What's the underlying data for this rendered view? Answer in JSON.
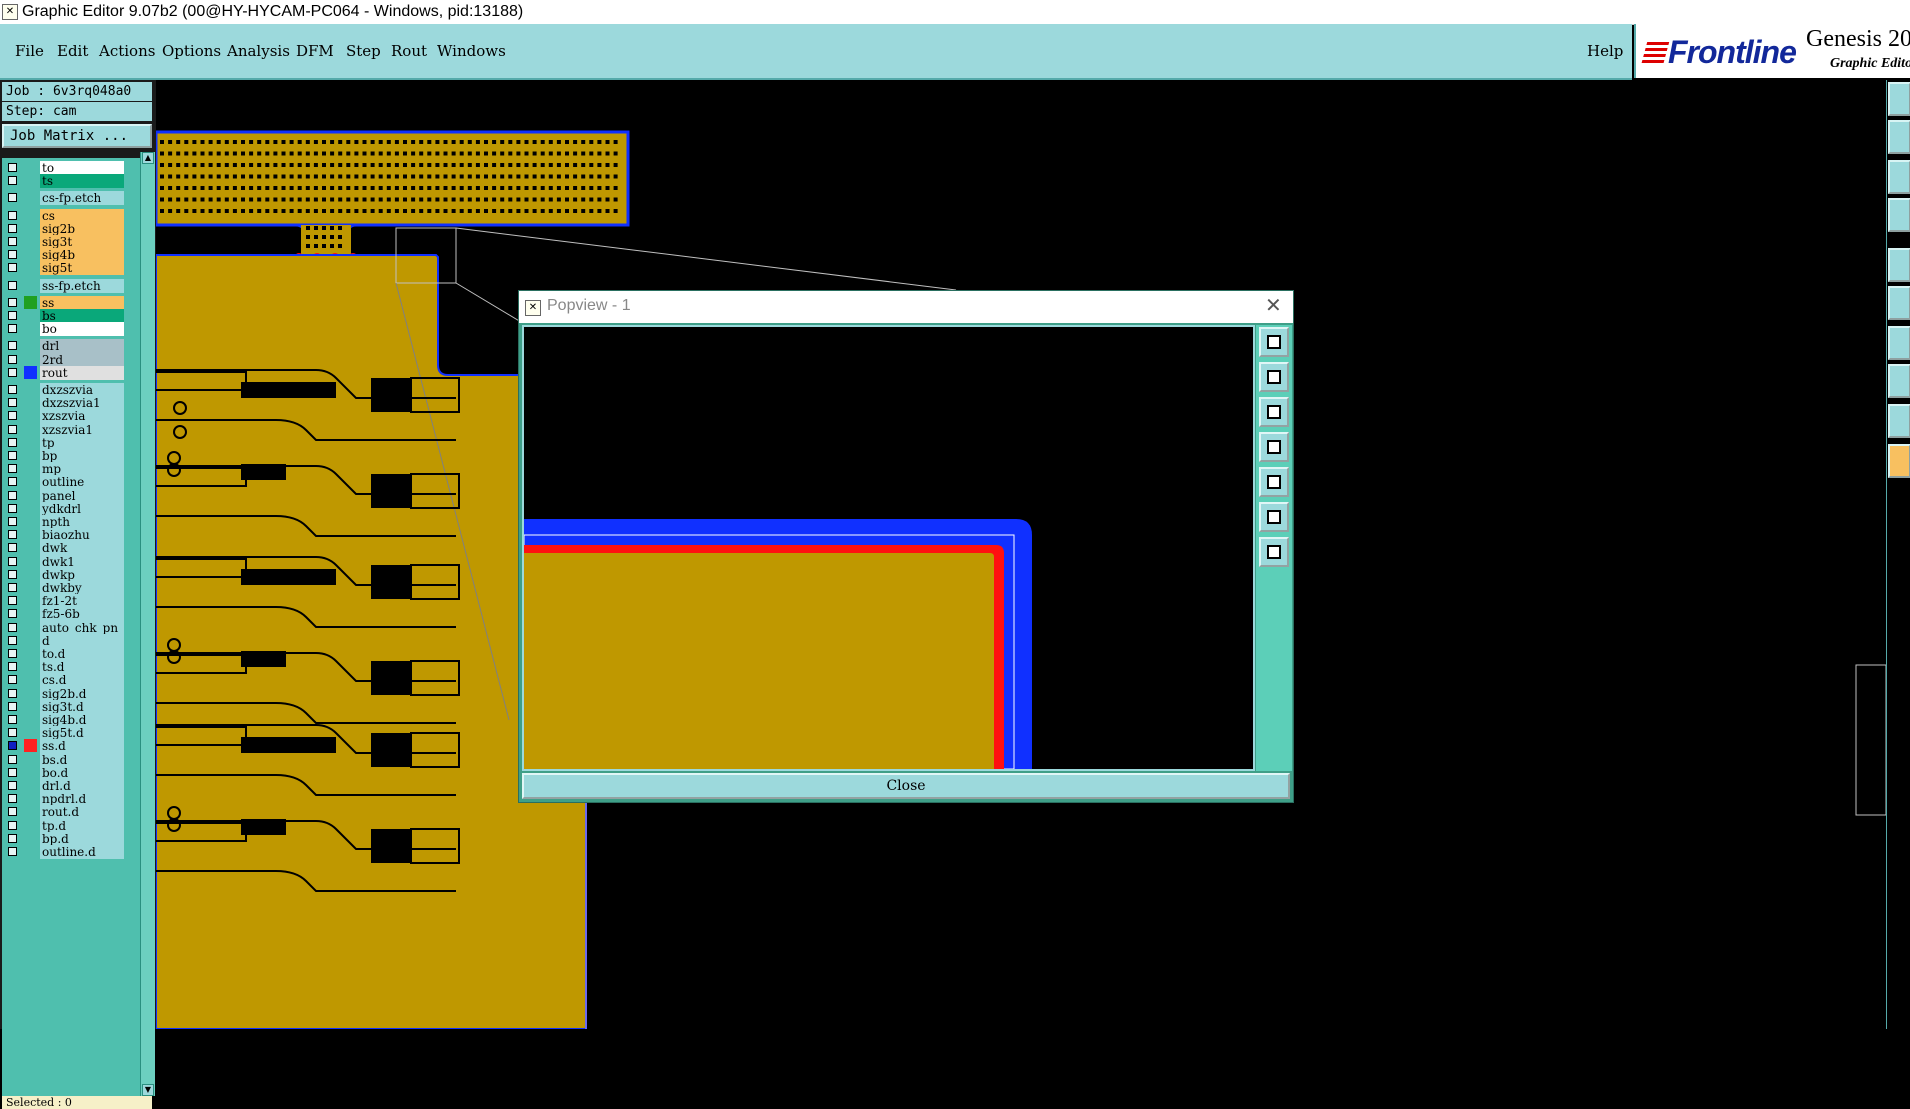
{
  "window": {
    "title": "Graphic Editor 9.07b2 (00@HY-HYCAM-PC064 - Windows, pid:13188)"
  },
  "menubar": {
    "items": [
      "File",
      "Edit",
      "Actions",
      "Options",
      "Analysis",
      "DFM",
      "Step",
      "Rout",
      "Windows"
    ],
    "help": "Help"
  },
  "brand": {
    "logo": "Frontline",
    "product": "Genesis 20",
    "subtitle": "Graphic Edito"
  },
  "job": {
    "job_line": "Job : 6v3rq048a0",
    "step_line": "Step: cam",
    "matrix_button": "Job Matrix ..."
  },
  "layers": [
    {
      "name": "to",
      "color": "#ffffff",
      "swatch": ""
    },
    {
      "name": "ts",
      "color": "#0aa87a",
      "swatch": ""
    },
    {
      "name": "cs-fp.etch",
      "color": "#9cd9dc",
      "swatch": "",
      "header": true
    },
    {
      "name": "cs",
      "color": "#f8c060",
      "swatch": ""
    },
    {
      "name": "sig2b",
      "color": "#f8c060",
      "swatch": ""
    },
    {
      "name": "sig3t",
      "color": "#f8c060",
      "swatch": ""
    },
    {
      "name": "sig4b",
      "color": "#f8c060",
      "swatch": ""
    },
    {
      "name": "sig5t",
      "color": "#f8c060",
      "swatch": ""
    },
    {
      "name": "ss-fp.etch",
      "color": "#9cd9dc",
      "swatch": "",
      "header": true
    },
    {
      "name": "ss",
      "color": "#f8c060",
      "swatch": "#20a020"
    },
    {
      "name": "bs",
      "color": "#0aa87a",
      "swatch": ""
    },
    {
      "name": "bo",
      "color": "#ffffff",
      "swatch": ""
    },
    {
      "name": "drl",
      "color": "#a8c0c8",
      "swatch": ""
    },
    {
      "name": "2rd",
      "color": "#a8c0c8",
      "swatch": ""
    },
    {
      "name": "rout",
      "color": "#e0e0e0",
      "swatch": "#1030ff"
    },
    {
      "name": "dxzszvia",
      "color": "#9cd9dc",
      "swatch": ""
    },
    {
      "name": "dxzszvia1",
      "color": "#9cd9dc",
      "swatch": ""
    },
    {
      "name": "xzszvia",
      "color": "#9cd9dc",
      "swatch": ""
    },
    {
      "name": "xzszvia1",
      "color": "#9cd9dc",
      "swatch": ""
    },
    {
      "name": "tp",
      "color": "#9cd9dc",
      "swatch": ""
    },
    {
      "name": "bp",
      "color": "#9cd9dc",
      "swatch": ""
    },
    {
      "name": "mp",
      "color": "#9cd9dc",
      "swatch": ""
    },
    {
      "name": "outline",
      "color": "#9cd9dc",
      "swatch": ""
    },
    {
      "name": "panel",
      "color": "#9cd9dc",
      "swatch": ""
    },
    {
      "name": "ydkdrl",
      "color": "#9cd9dc",
      "swatch": ""
    },
    {
      "name": "npth",
      "color": "#9cd9dc",
      "swatch": ""
    },
    {
      "name": "biaozhu",
      "color": "#9cd9dc",
      "swatch": ""
    },
    {
      "name": "dwk",
      "color": "#9cd9dc",
      "swatch": ""
    },
    {
      "name": "dwk1",
      "color": "#9cd9dc",
      "swatch": ""
    },
    {
      "name": "dwkp",
      "color": "#9cd9dc",
      "swatch": ""
    },
    {
      "name": "dwkby",
      "color": "#9cd9dc",
      "swatch": ""
    },
    {
      "name": "fz1-2t",
      "color": "#9cd9dc",
      "swatch": ""
    },
    {
      "name": "fz5-6b",
      "color": "#9cd9dc",
      "swatch": ""
    },
    {
      "name": "auto_chk_pn",
      "color": "#9cd9dc",
      "swatch": ""
    },
    {
      "name": "d",
      "color": "#9cd9dc",
      "swatch": ""
    },
    {
      "name": "to.d",
      "color": "#9cd9dc",
      "swatch": ""
    },
    {
      "name": "ts.d",
      "color": "#9cd9dc",
      "swatch": ""
    },
    {
      "name": "cs.d",
      "color": "#9cd9dc",
      "swatch": ""
    },
    {
      "name": "sig2b.d",
      "color": "#9cd9dc",
      "swatch": ""
    },
    {
      "name": "sig3t.d",
      "color": "#9cd9dc",
      "swatch": ""
    },
    {
      "name": "sig4b.d",
      "color": "#9cd9dc",
      "swatch": ""
    },
    {
      "name": "sig5t.d",
      "color": "#9cd9dc",
      "swatch": ""
    },
    {
      "name": "ss.d",
      "color": "#9cd9dc",
      "swatch": "#ff2020",
      "marked": true
    },
    {
      "name": "bs.d",
      "color": "#9cd9dc",
      "swatch": ""
    },
    {
      "name": "bo.d",
      "color": "#9cd9dc",
      "swatch": ""
    },
    {
      "name": "drl.d",
      "color": "#9cd9dc",
      "swatch": ""
    },
    {
      "name": "npdrl.d",
      "color": "#9cd9dc",
      "swatch": ""
    },
    {
      "name": "rout.d",
      "color": "#9cd9dc",
      "swatch": ""
    },
    {
      "name": "tp.d",
      "color": "#9cd9dc",
      "swatch": ""
    },
    {
      "name": "bp.d",
      "color": "#9cd9dc",
      "swatch": ""
    },
    {
      "name": "outline.d",
      "color": "#9cd9dc",
      "swatch": ""
    }
  ],
  "status": {
    "selected": "Selected : 0"
  },
  "popview": {
    "title": "Popview - 1",
    "close_label": "Close"
  },
  "colors": {
    "board_fill": "#bf9800",
    "outline_blue": "#1030ff",
    "pad_red": "#ff1010",
    "panel_teal": "#9cd9dc"
  }
}
